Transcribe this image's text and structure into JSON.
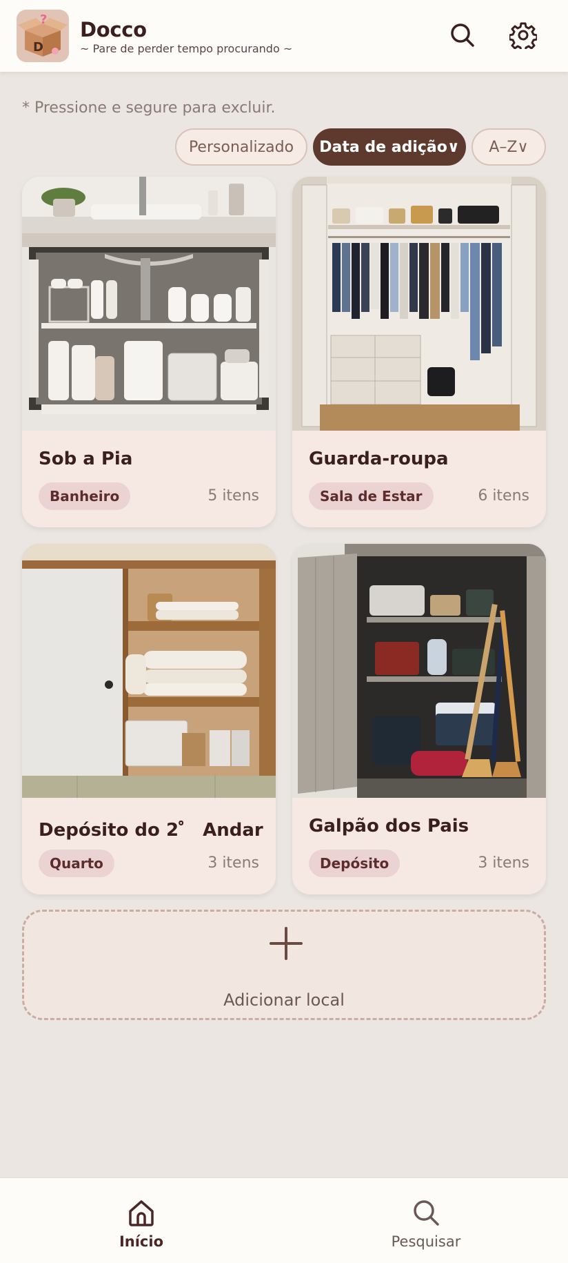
{
  "header": {
    "title": "Docco",
    "tagline": "~ Pare de perder tempo procurando ~",
    "logo_letter": "D",
    "logo_mark": "?",
    "search_icon": "search-icon",
    "settings_icon": "gear-icon"
  },
  "hint": "* Pressione e segure para excluir.",
  "sort": {
    "options": [
      {
        "label": "Personalizado",
        "active": false
      },
      {
        "label": "Data de adição∨",
        "active": true
      },
      {
        "label": "A–Z∨",
        "active": false
      }
    ]
  },
  "locations": [
    {
      "name": "Sob a Pia",
      "tag": "Banheiro",
      "count": "5 itens",
      "image": "under-sink-cabinet"
    },
    {
      "name": "Guarda-roupa",
      "tag": "Sala de Estar",
      "count": "6 itens",
      "image": "wardrobe-closet"
    },
    {
      "name": "Depósito do 2゜ Andar",
      "tag": "Quarto",
      "count": "3 itens",
      "image": "storage-closet-futons"
    },
    {
      "name": "Galpão dos Pais",
      "tag": "Depósito",
      "count": "3 itens",
      "image": "storage-shed"
    }
  ],
  "add_location": {
    "label": "Adicionar local"
  },
  "nav": {
    "home_label": "Início",
    "search_label": "Pesquisar"
  },
  "colors": {
    "accent": "#5e3a2e",
    "background": "#ebe6e1",
    "card": "#f6e9e3",
    "tag": "#ecd3d3"
  }
}
